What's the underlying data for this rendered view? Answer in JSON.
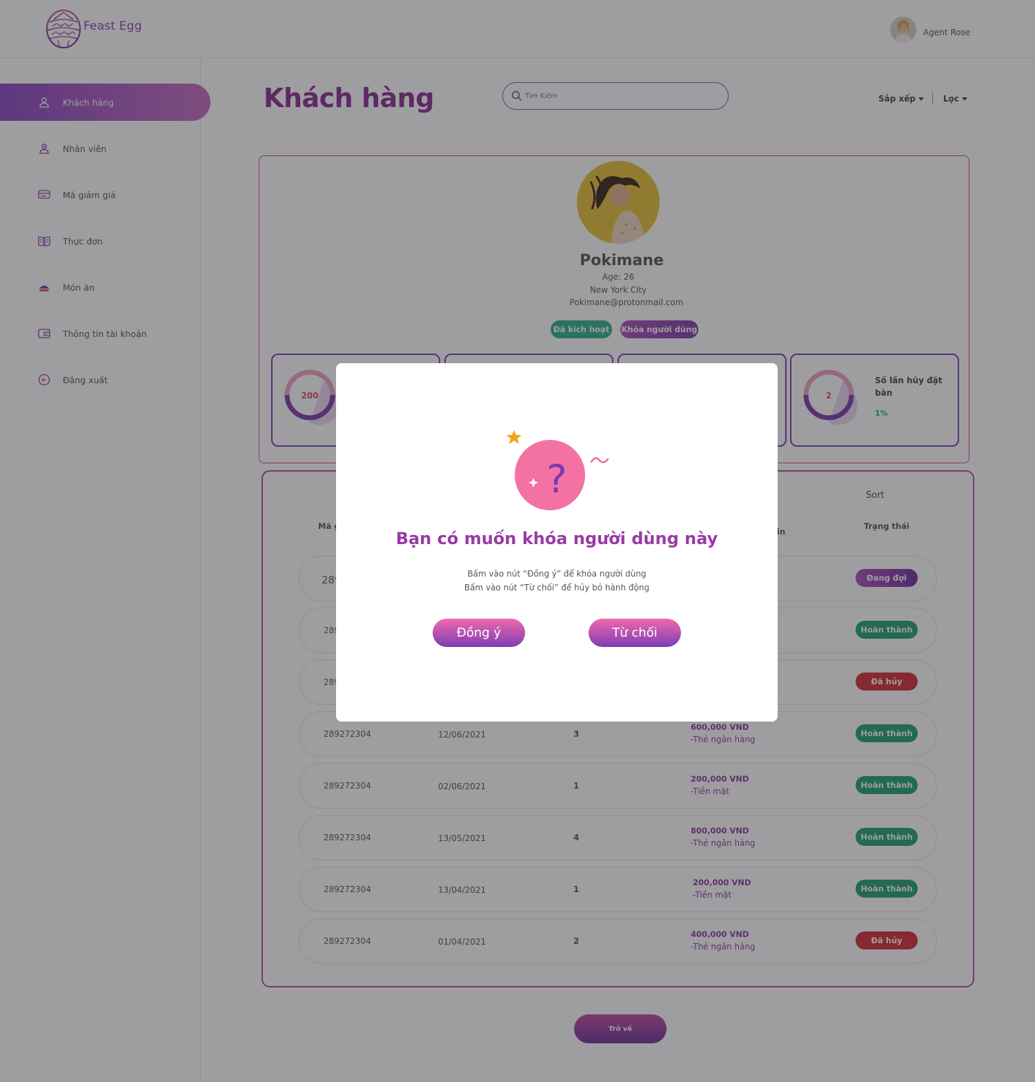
{
  "header": {
    "logo_text": "Feast Egg",
    "user_name": "Agent Rose"
  },
  "sidebar": {
    "items": [
      {
        "label": "Khách hàng",
        "icon": "user-icon",
        "active": true
      },
      {
        "label": "Nhân viên",
        "icon": "employee-icon"
      },
      {
        "label": "Mã giảm giá",
        "icon": "coupon-icon"
      },
      {
        "label": "Thực đơn",
        "icon": "menu-book-icon"
      },
      {
        "label": "Món ăn",
        "icon": "dish-icon"
      },
      {
        "label": "Thông tin tài khoản",
        "icon": "wallet-icon"
      },
      {
        "label": "Đăng xuất",
        "icon": "logout-icon"
      }
    ]
  },
  "main": {
    "title": "Khách hàng",
    "search_placeholder": "Tìm Kiếm",
    "sort_label": "Sắp xếp",
    "filter_label": "Lọc"
  },
  "profile": {
    "name": "Pokimane",
    "age": "Age: 26",
    "city": "New York City",
    "email": "Pokimane@protonmail.com",
    "status_badge": "Đã kích hoạt",
    "lock_button": "Khóa người dùng"
  },
  "stats": [
    {
      "value": "200",
      "label": "",
      "percent": ""
    },
    {
      "value": "2",
      "label": "Số lần hủy đặt bàn",
      "percent": "1%"
    }
  ],
  "orders": {
    "sort_text": "Sort",
    "col_first_partial": "Mã g",
    "col_partial": "in",
    "col_status": "Trạng thái",
    "rows": [
      {
        "id": "289",
        "date": "",
        "qty": "",
        "amount": "",
        "method": "",
        "status": "Đang đợi",
        "status_type": "wait"
      },
      {
        "id": "289",
        "date": "",
        "qty": "",
        "amount": "",
        "method": "",
        "status": "Hoàn thành",
        "status_type": "done"
      },
      {
        "id": "289",
        "date": "",
        "qty": "",
        "amount": "",
        "method": "",
        "status": "Đã hủy",
        "status_type": "cancel"
      },
      {
        "id": "289272304",
        "date": "12/06/2021",
        "qty": "3",
        "amount": "600,000 VND",
        "method": "-Thẻ ngân hàng",
        "status": "Hoàn thành",
        "status_type": "done"
      },
      {
        "id": "289272304",
        "date": "02/06/2021",
        "qty": "1",
        "amount": "200,000 VND",
        "method": "-Tiền mặt",
        "status": "Hoàn thành",
        "status_type": "done"
      },
      {
        "id": "289272304",
        "date": "13/05/2021",
        "qty": "4",
        "amount": "800,000 VND",
        "method": "-Thẻ ngân hàng",
        "status": "Hoàn thành",
        "status_type": "done"
      },
      {
        "id": "289272304",
        "date": "13/04/2021",
        "qty": "1",
        "amount": "200,000 VND",
        "method": "-Tiền mặt",
        "status": "Hoàn thành",
        "status_type": "done"
      },
      {
        "id": "289272304",
        "date": "01/04/2021",
        "qty": "2",
        "amount": "400,000 VND",
        "method": "-Thẻ ngân hàng",
        "status": "Đã hủy",
        "status_type": "cancel"
      }
    ],
    "back_button": "Trở về"
  },
  "modal": {
    "title": "Bạn có muốn khóa người dùng này",
    "line1": "Bấm vào nút “Đồng ý” để khóa người dùng",
    "line2": "Bấm vào nút “Từ chối” để hủy bỏ hành động",
    "confirm": "Đồng ý",
    "cancel": "Từ chối"
  },
  "colors": {
    "accent_purple": "#8a2b92",
    "accent_pink": "#e2466b",
    "status_done": "#1f9f74",
    "status_cancel": "#d42a35"
  }
}
